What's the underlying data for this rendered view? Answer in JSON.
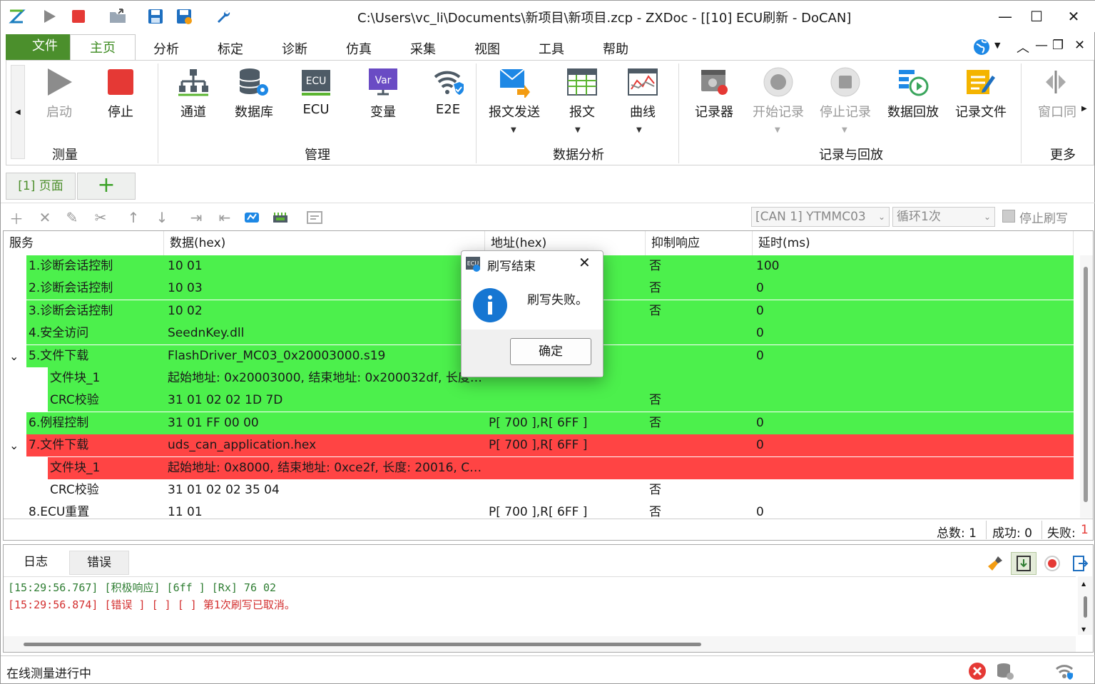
{
  "window": {
    "title": "C:\\Users\\vc_li\\Documents\\新项目\\新项目.zcp - ZXDoc - [[10] ECU刷新 - DoCAN]"
  },
  "menu": {
    "file": "文件",
    "tabs": [
      "主页",
      "分析",
      "标定",
      "诊断",
      "仿真",
      "采集",
      "视图",
      "工具",
      "帮助"
    ]
  },
  "ribbon": {
    "measure": {
      "label": "测量",
      "start": "启动",
      "stop": "停止"
    },
    "manage": {
      "label": "管理",
      "channel": "通道",
      "database": "数据库",
      "ecu": "ECU",
      "variable": "变量",
      "e2e": "E2E"
    },
    "analysis": {
      "label": "数据分析",
      "send": "报文发送",
      "message": "报文",
      "curve": "曲线"
    },
    "record": {
      "label": "记录与回放",
      "recorder": "记录器",
      "start_rec": "开始记录",
      "stop_rec": "停止记录",
      "replay": "数据回放",
      "rec_file": "记录文件"
    },
    "more": {
      "label": "更多",
      "window": "窗口同"
    }
  },
  "doc_tabs": {
    "page": "[1] 页面",
    "add": "+"
  },
  "toolbar": {
    "channel_select": "[CAN 1] YTMMC03",
    "loop_select": "循环1次",
    "stop_flash": "停止刷写"
  },
  "table": {
    "headers": [
      "服务",
      "数据(hex)",
      "地址(hex)",
      "抑制响应",
      "延时(ms)"
    ],
    "rows": [
      {
        "service": "1.诊断会话控制",
        "data": "10 01",
        "addr": "",
        "suppress": "否",
        "delay": "100",
        "status": "ok",
        "indent": 0,
        "expand": ""
      },
      {
        "service": "2.诊断会话控制",
        "data": "10 03",
        "addr": "",
        "suppress": "否",
        "delay": "0",
        "status": "ok",
        "indent": 0,
        "expand": ""
      },
      {
        "service": "3.诊断会话控制",
        "data": "10 02",
        "addr": "",
        "suppress": "否",
        "delay": "0",
        "status": "ok",
        "indent": 0,
        "expand": ""
      },
      {
        "service": "4.安全访问",
        "data": "SeednKey.dll",
        "addr": "",
        "suppress": "",
        "delay": "0",
        "status": "ok",
        "indent": 0,
        "expand": ""
      },
      {
        "service": "5.文件下载",
        "data": "FlashDriver_MC03_0x20003000.s19",
        "addr": "",
        "suppress": "",
        "delay": "0",
        "status": "ok",
        "indent": 0,
        "expand": "⌄"
      },
      {
        "service": "文件块_1",
        "data": "起始地址: 0x20003000, 结束地址: 0x200032df, 长度…",
        "addr": "",
        "suppress": "",
        "delay": "",
        "status": "ok",
        "indent": 1,
        "expand": ""
      },
      {
        "service": "CRC校验",
        "data": "31 01 02 02 1D 7D",
        "addr": "",
        "suppress": "否",
        "delay": "",
        "status": "ok",
        "indent": 1,
        "expand": ""
      },
      {
        "service": "6.例程控制",
        "data": "31 01 FF 00 00",
        "addr": "P[ 700 ],R[ 6FF ]",
        "suppress": "否",
        "delay": "0",
        "status": "ok",
        "indent": 0,
        "expand": ""
      },
      {
        "service": "7.文件下载",
        "data": "uds_can_application.hex",
        "addr": "P[ 700 ],R[ 6FF ]",
        "suppress": "",
        "delay": "0",
        "status": "fail",
        "indent": 0,
        "expand": "⌄"
      },
      {
        "service": "文件块_1",
        "data": "起始地址: 0x8000, 结束地址: 0xce2f, 长度: 20016, C…",
        "addr": "",
        "suppress": "",
        "delay": "",
        "status": "fail",
        "indent": 1,
        "expand": ""
      },
      {
        "service": "CRC校验",
        "data": "31 01 02 02 35 04",
        "addr": "",
        "suppress": "否",
        "delay": "",
        "status": "none",
        "indent": 1,
        "expand": ""
      },
      {
        "service": "8.ECU重置",
        "data": "11 01",
        "addr": "P[ 700 ],R[ 6FF ]",
        "suppress": "否",
        "delay": "0",
        "status": "none",
        "indent": 0,
        "expand": ""
      }
    ],
    "summary": {
      "total": "总数: 1",
      "success": "成功: 0",
      "fail_label": "失败: ",
      "fail_value": "1"
    }
  },
  "log": {
    "tabs": [
      "日志",
      "错误"
    ],
    "lines": [
      {
        "text": "[15:29:56.767] [积极响应] [6ff ] [Rx] 76 02",
        "color": "#2e7d32"
      },
      {
        "text": "[15:29:56.874] [错误 ] [ ] [ ] 第1次刷写已取消。",
        "color": "#d32f2f"
      }
    ]
  },
  "status": {
    "text": "在线测量进行中"
  },
  "dialog": {
    "title": "刷写结束",
    "message": "刷写失败。",
    "ok": "确定"
  },
  "colors": {
    "ok": "#4cf04c",
    "fail": "#ff4444",
    "accent": "#4b8f2c"
  }
}
